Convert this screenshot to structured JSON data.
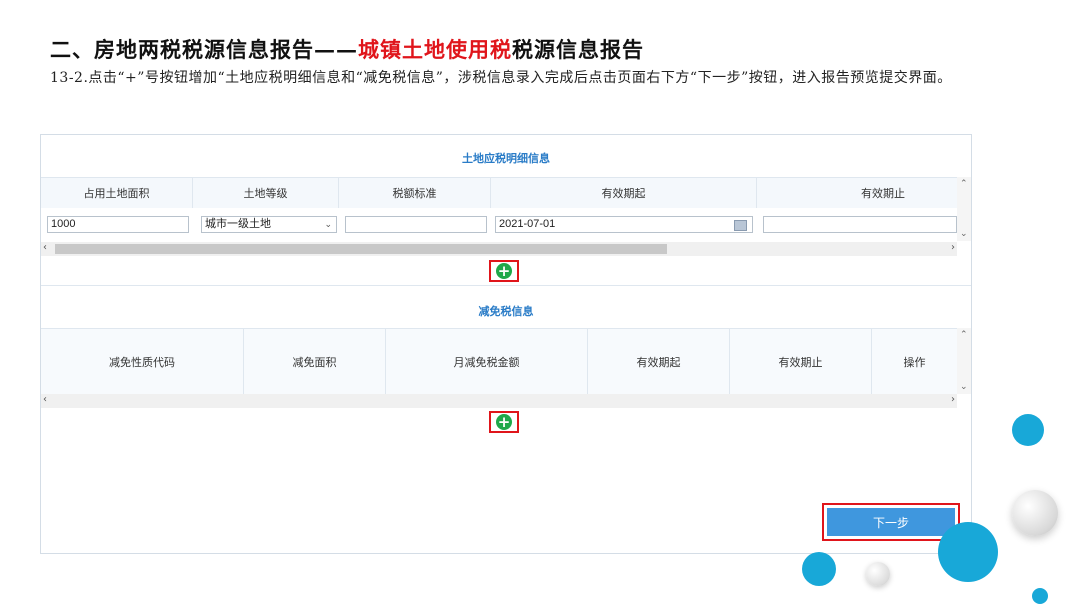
{
  "slide": {
    "title_prefix": "二、房地两税税源信息报告——",
    "title_highlight": "城镇土地使用税",
    "title_suffix": "税源信息报告",
    "description": "13-2.点击“+”号按钮增加“土地应税明细信息和“减免税信息”，涉税信息录入完成后点击页面右下方“下一步”按钮，进入报告预览提交界面。"
  },
  "land_section": {
    "title": "土地应税明细信息",
    "columns": [
      "占用土地面积",
      "土地等级",
      "税额标准",
      "有效期起",
      "有效期止"
    ],
    "row": {
      "area": "1000",
      "grade": "城市一级土地",
      "tax_standard": "",
      "valid_from": "2021-07-01",
      "valid_to": ""
    }
  },
  "relief_section": {
    "title": "减免税信息",
    "columns": [
      "减免性质代码",
      "减免面积",
      "月减免税金额",
      "有效期起",
      "有效期止",
      "操作"
    ]
  },
  "icons": {
    "add": "plus-circle-icon",
    "calendar": "calendar-icon",
    "select": "chevron-down-icon",
    "scroll_left": "chevron-left-icon",
    "scroll_right": "chevron-right-icon"
  },
  "buttons": {
    "add_symbol": "+",
    "next": "下一步"
  },
  "colors": {
    "highlight_red": "#e0151b",
    "section_title_blue": "#2a7cc7",
    "add_green": "#1fa84a",
    "next_button_blue": "#3f97de",
    "decor_cyan": "#18a8d8"
  }
}
